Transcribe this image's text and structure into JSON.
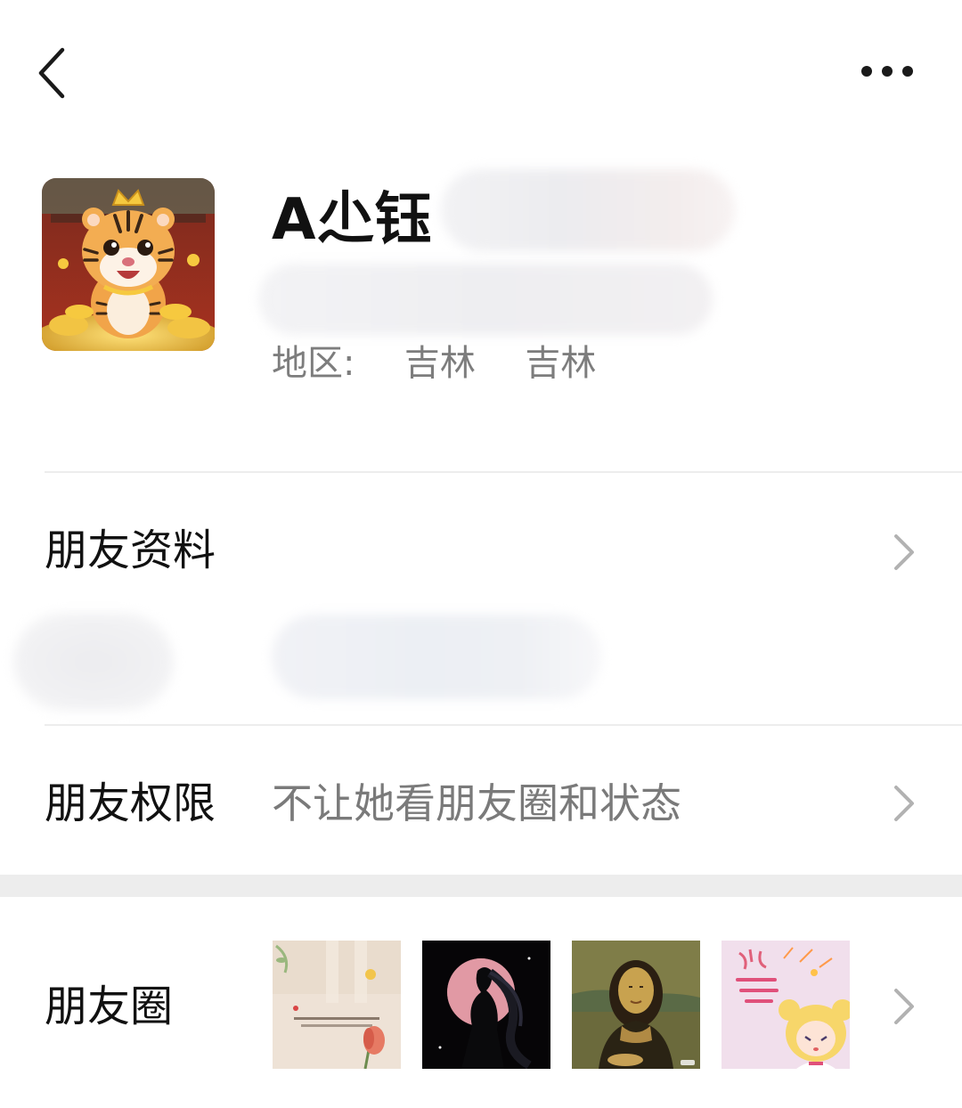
{
  "header": {
    "back_icon": "chevron-left-icon",
    "more_icon": "more-dots-icon"
  },
  "profile": {
    "nickname": "A尐钰",
    "region_label": "地区:",
    "region_province": "吉林",
    "region_city": "吉林",
    "avatar_icon": "tiger-avatar"
  },
  "rows": {
    "friend_info": {
      "label": "朋友资料"
    },
    "friend_permission": {
      "label": "朋友权限",
      "value": "不让她看朋友圈和状态"
    },
    "moments": {
      "label": "朋友圈",
      "thumbnails": [
        {
          "name": "moment-thumb-quote-flower"
        },
        {
          "name": "moment-thumb-silhouette"
        },
        {
          "name": "moment-thumb-portrait-painting"
        },
        {
          "name": "moment-thumb-cartoon-girl"
        }
      ]
    }
  },
  "colors": {
    "background": "#ffffff",
    "text_primary": "#111111",
    "text_secondary": "#7a7a7a",
    "divider": "#ededed",
    "chevron": "#b2b2b2"
  }
}
